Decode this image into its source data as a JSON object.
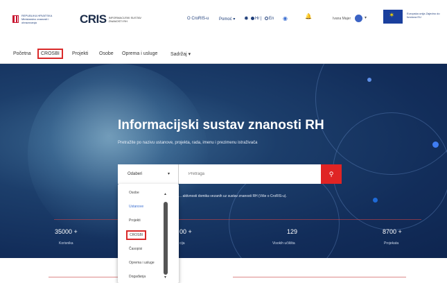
{
  "header": {
    "ministry_name": "REPUBLIKA HRVATSKA Ministarstvo znanosti i obrazovanja",
    "logo_text": "CRIS",
    "logo_subtitle": "INFORMACIJSKI SUSTAV ZNANOSTI RH",
    "croris_link": "O CroRIS-u",
    "help_label": "Pomoć ▾",
    "lang_hr": "Hr",
    "lang_en": "En",
    "user_name": "Ivana Majer",
    "eu_text": "Europska unija Zajedno do fondova EU"
  },
  "nav": {
    "items": [
      "Početna",
      "CROSBI",
      "Projekti",
      "Osobe",
      "Oprema i usluge",
      "Sadržaj ▾"
    ]
  },
  "hero": {
    "title": "Informacijski sustav znanosti RH",
    "subtitle": "Pretražite po nazivu ustanove, projekta, rada, imenu i prezimenu istraživača",
    "search_select": "Odaberi",
    "search_placeholder": "Pretraga",
    "hint": "... aktivnosti domika vezanih uz sustav znanosti RH (Više o CroRIS-u).",
    "stats": [
      {
        "value": "35000 +",
        "label": "Korisnika"
      },
      {
        "value": "00 +",
        "label": "cija"
      },
      {
        "value": "129",
        "label": "Visokih učilišta"
      },
      {
        "value": "8700 +",
        "label": "Projekata"
      }
    ]
  },
  "dropdown": {
    "options": [
      "Osobe",
      "Ustanove",
      "Projekti",
      "CROSBI",
      "Časopisi",
      "Oprema i usluge",
      "Događanja"
    ],
    "selected": "Ustanove",
    "highlighted": "CROSBI"
  },
  "colors": {
    "accent_red": "#d92929",
    "hero_blue": "#1c3e6b",
    "link_blue": "#1f3e7a"
  }
}
